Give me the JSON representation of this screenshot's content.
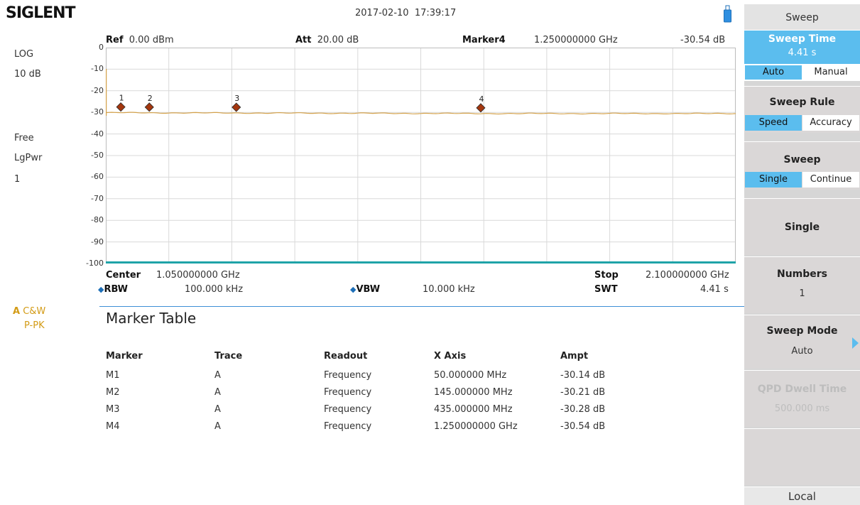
{
  "topbar": {
    "logo": "SIGLENT",
    "date": "2017-02-10",
    "time": "17:39:17"
  },
  "left": {
    "scale_type": "LOG",
    "scale_div": "10 dB",
    "trigger": "Free",
    "avg_type": "LgPwr",
    "avg_count": "1",
    "trace_label": "A",
    "trace_mode": "C&W",
    "detector": "P-PK"
  },
  "header": {
    "ref_label": "Ref",
    "ref_value": "0.00 dBm",
    "att_label": "Att",
    "att_value": "20.00 dB",
    "marker_label": "Marker4",
    "marker_freq": "1.250000000 GHz",
    "marker_ampt": "-30.54 dB"
  },
  "graph": {
    "y_ticks": [
      "0",
      "-10",
      "-20",
      "-30",
      "-40",
      "-50",
      "-60",
      "-70",
      "-80",
      "-90",
      "-100"
    ],
    "trace_color": "#d4a24c",
    "marker_color": "#a3360e",
    "markers": [
      {
        "label": "1",
        "freq_mhz": 50,
        "ampt_db": -30.14
      },
      {
        "label": "2",
        "freq_mhz": 145,
        "ampt_db": -30.21
      },
      {
        "label": "3",
        "freq_mhz": 435,
        "ampt_db": -30.28
      },
      {
        "label": "4",
        "freq_mhz": 1250,
        "ampt_db": -30.54
      }
    ]
  },
  "params": {
    "center_label": "Center",
    "center_value": "1.050000000 GHz",
    "stop_label": "Stop",
    "stop_value": "2.100000000 GHz",
    "rbw_label": "RBW",
    "rbw_value": "100.000 kHz",
    "vbw_label": "VBW",
    "vbw_value": "10.000 kHz",
    "swt_label": "SWT",
    "swt_value": "4.41 s"
  },
  "marker_table": {
    "title": "Marker Table",
    "columns": [
      "Marker",
      "Trace",
      "Readout",
      "X Axis",
      "Ampt"
    ],
    "rows": [
      [
        "M1",
        "A",
        "Frequency",
        "50.000000 MHz",
        "-30.14 dB"
      ],
      [
        "M2",
        "A",
        "Frequency",
        "145.000000 MHz",
        "-30.21 dB"
      ],
      [
        "M3",
        "A",
        "Frequency",
        "435.000000 MHz",
        "-30.28 dB"
      ],
      [
        "M4",
        "A",
        "Frequency",
        "1.250000000 GHz",
        "-30.54 dB"
      ]
    ]
  },
  "softkeys": {
    "menu_title": "Sweep",
    "sweep_time_title": "Sweep Time",
    "sweep_time_value": "4.41 s",
    "sweep_time_auto": "Auto",
    "sweep_time_manual": "Manual",
    "sweep_rule_title": "Sweep Rule",
    "sweep_rule_speed": "Speed",
    "sweep_rule_accuracy": "Accuracy",
    "sweep_title": "Sweep",
    "sweep_single": "Single",
    "sweep_continue": "Continue",
    "single_label": "Single",
    "numbers_title": "Numbers",
    "numbers_value": "1",
    "sweep_mode_title": "Sweep Mode",
    "sweep_mode_value": "Auto",
    "qpd_title": "QPD Dwell Time",
    "qpd_value": "500.000 ms",
    "local_label": "Local"
  }
}
